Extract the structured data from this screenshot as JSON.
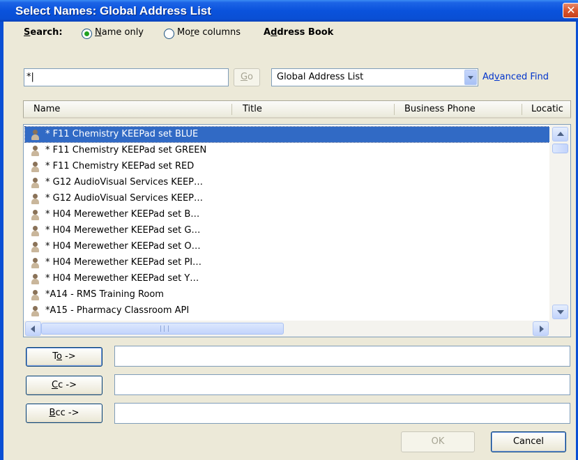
{
  "window": {
    "title": "Select Names: Global Address List",
    "close_symbol": "✕"
  },
  "search": {
    "label_prefix": "",
    "label_key": "S",
    "label_rest": "earch:",
    "name_only_key": "N",
    "name_only_rest": "ame only",
    "more_columns_pre": "Mo",
    "more_columns_key": "r",
    "more_columns_rest": "e columns",
    "query_value": "*|",
    "go_key": "G",
    "go_rest": "o",
    "selected_option": "Name only"
  },
  "address_book": {
    "label_pre": "A",
    "label_key": "d",
    "label_rest": "dress Book",
    "selected": "Global Address List",
    "advanced_pre": "Ad",
    "advanced_key": "v",
    "advanced_rest": "anced Find"
  },
  "columns": [
    "Name",
    "Title",
    "Business Phone",
    "Locatic"
  ],
  "entries": [
    "* F11 Chemistry KEEPad set BLUE",
    "* F11 Chemistry KEEPad set GREEN",
    "* F11 Chemistry KEEPad set RED",
    "* G12 AudioVisual Services KEEP…",
    "* G12 AudioVisual Services KEEP…",
    "* H04 Merewether KEEPad set B…",
    "* H04 Merewether KEEPad set G…",
    "* H04 Merewether KEEPad set O…",
    "* H04 Merewether KEEPad set PI…",
    "* H04 Merewether KEEPad set Y…",
    "*A14 - RMS Training Room",
    "*A15 - Pharmacy Classroom API"
  ],
  "selected_index": 0,
  "scroll": {
    "grip": "III"
  },
  "recipients": {
    "to_pre": "T",
    "to_key": "o",
    "to_rest": " ->",
    "cc_pre": "",
    "cc_key": "C",
    "cc_rest": "c ->",
    "bcc_pre": "",
    "bcc_key": "B",
    "bcc_rest": "cc ->"
  },
  "buttons": {
    "ok": "OK",
    "cancel": "Cancel"
  },
  "colors": {
    "titlebar": "#0a4fd4",
    "selection": "#316ac5",
    "link": "#0033cc",
    "dialog_bg": "#ece9d8"
  },
  "icons": {
    "entry_icon": "person-icon",
    "combo_arrow": "chevron-down-icon",
    "close": "close-icon"
  }
}
